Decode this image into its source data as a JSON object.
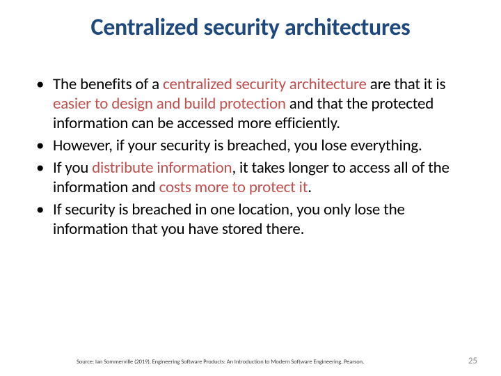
{
  "title": "Centralized security architectures",
  "bullets": [
    {
      "segments": [
        {
          "text": "The benefits of a ",
          "hl": false
        },
        {
          "text": "centralized security architecture ",
          "hl": true
        },
        {
          "text": "are that it is ",
          "hl": false
        },
        {
          "text": "easier to design and build protection ",
          "hl": true
        },
        {
          "text": "and that the protected information can be accessed more efficiently.",
          "hl": false
        }
      ]
    },
    {
      "segments": [
        {
          "text": "However, if your security is breached, you lose everything.",
          "hl": false
        }
      ]
    },
    {
      "segments": [
        {
          "text": "If you ",
          "hl": false
        },
        {
          "text": "distribute information",
          "hl": true
        },
        {
          "text": ", it takes longer to access all of the information and ",
          "hl": false
        },
        {
          "text": "costs more to protect it",
          "hl": true
        },
        {
          "text": ".",
          "hl": false
        }
      ]
    },
    {
      "segments": [
        {
          "text": "If security is breached in one location, you only lose the information that you have stored there.",
          "hl": false
        }
      ]
    }
  ],
  "source": "Source: Ian Sommerville (2019), Engineering Software Products: An Introduction to Modern Software Engineering, Pearson.",
  "page_number": "25"
}
